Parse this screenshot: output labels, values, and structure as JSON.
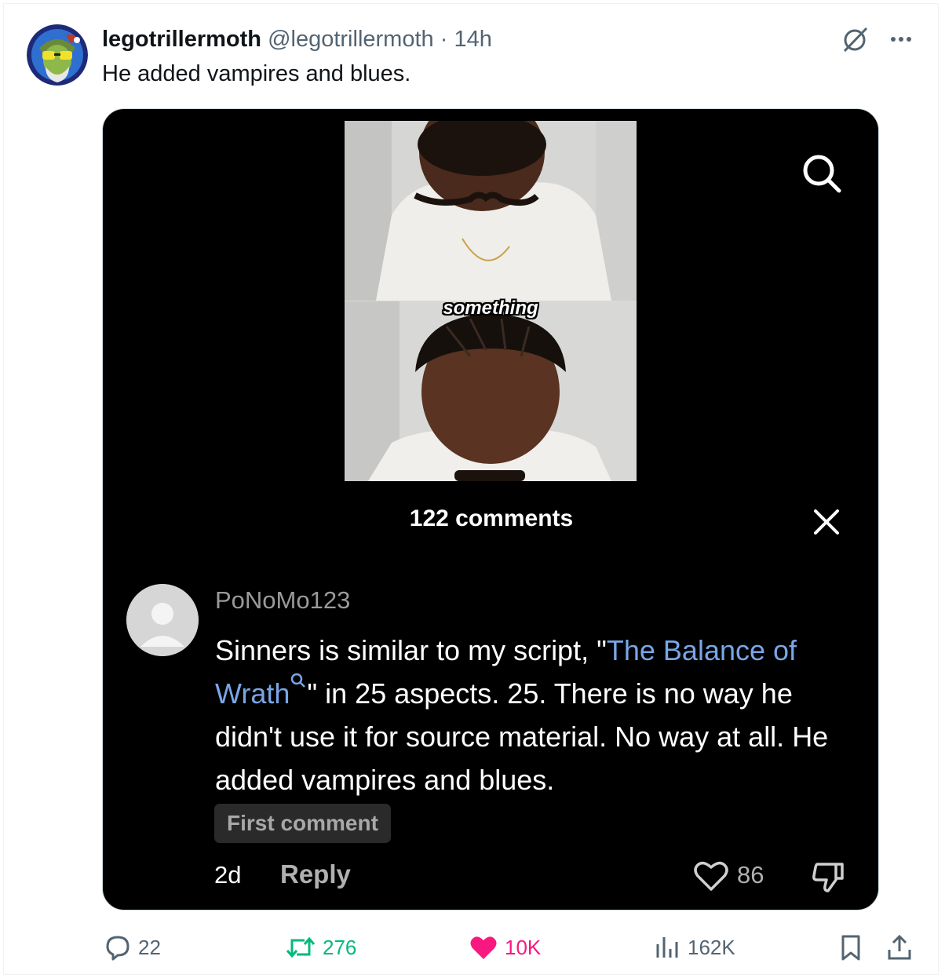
{
  "author": {
    "display_name": "legotrillermoth",
    "handle": "@legotrillermoth",
    "separator": "·",
    "timestamp": "14h"
  },
  "tweet": {
    "text": "He added vampires and blues."
  },
  "media": {
    "video_caption": "something",
    "comments_count_label": "122 comments",
    "comment": {
      "username": "PoNoMo123",
      "text_part1": "Sinners is similar to my script, \"",
      "link_text": "The Balance of Wrath",
      "text_part2": "\" in 25 aspects. 25. There is no way he didn't use it for source material. No way at all. He added vampires and blues.",
      "badge": "First comment",
      "age": "2d",
      "reply_label": "Reply",
      "like_count": "86"
    }
  },
  "actions": {
    "replies": "22",
    "reposts": "276",
    "likes": "10K",
    "views": "162K"
  },
  "colors": {
    "repost_green": "#00ba7c",
    "like_pink": "#f91880",
    "link_blue": "#78a6e8",
    "muted": "#536471"
  }
}
